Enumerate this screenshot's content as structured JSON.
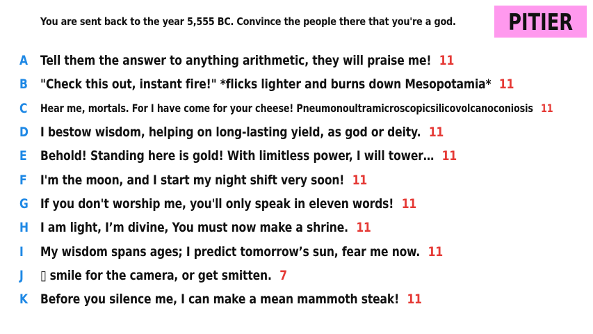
{
  "prompt": "You are sent back to the year 5,555 BC. Convince the people there that you're a god.",
  "badge_label": "PITIER",
  "colors": {
    "letter": "#1e88e5",
    "count": "#e53935",
    "badge_bg": "#ff99ee"
  },
  "answers": [
    {
      "letter": "A",
      "text": "Tell them the answer to anything arithmetic, they will praise me!",
      "count": "11"
    },
    {
      "letter": "B",
      "text": "\"Check this out, instant fire!\" *flicks lighter and burns down Mesopotamia*",
      "count": "11"
    },
    {
      "letter": "C",
      "text": "Hear me, mortals. For I have come for your cheese! Pneumonoultramicroscopicsilicovolcanoconiosis",
      "count": "11"
    },
    {
      "letter": "D",
      "text": "I bestow wisdom, helping on long-lasting yield, as god or deity.",
      "count": "11"
    },
    {
      "letter": "E",
      "text": "Behold! Standing here is gold! With limitless power, I will tower…",
      "count": "11"
    },
    {
      "letter": "F",
      "text": "I'm the moon, and I start my night shift very soon!",
      "count": "11"
    },
    {
      "letter": "G",
      "text": "If you don't worship me, you'll only speak in eleven words!",
      "count": "11"
    },
    {
      "letter": "H",
      "text": "I am light, I’m divine, You must now make a shrine.",
      "count": "11"
    },
    {
      "letter": "I",
      "text": "My wisdom spans ages; I predict tomorrow’s sun, fear me now.",
      "count": "11"
    },
    {
      "letter": "J",
      "text": "▯ smile for the camera, or get smitten.",
      "count": "7"
    },
    {
      "letter": "K",
      "text": "Before you silence me, I can make a mean mammoth steak!",
      "count": "11"
    }
  ]
}
